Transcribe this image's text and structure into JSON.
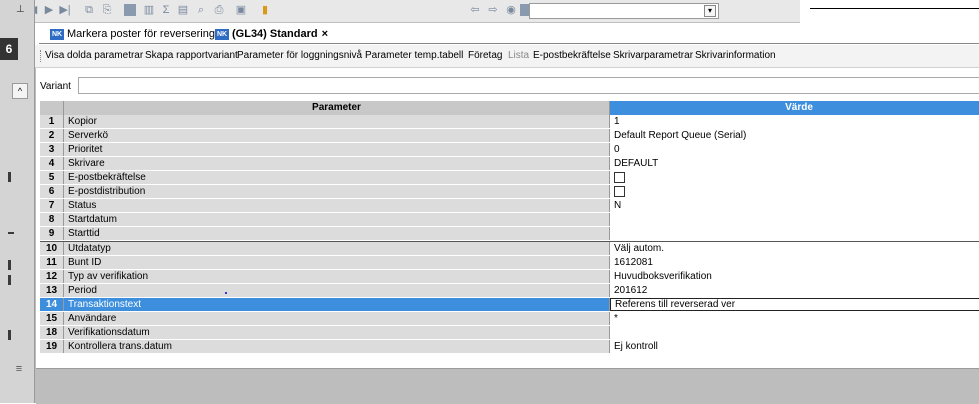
{
  "tabs": [
    {
      "label": "Markera poster för reversering",
      "badge": "NK",
      "active": false,
      "close": "×"
    },
    {
      "label": "(GL34) Standard",
      "badge": "NK",
      "active": true,
      "close": "×"
    }
  ],
  "left_strip": {
    "number": "6"
  },
  "actions": [
    {
      "label": "Visa dolda parametrar",
      "enabled": true
    },
    {
      "label": "Skapa rapportvariant",
      "enabled": true
    },
    {
      "label": "Parameter för loggningsnivå",
      "enabled": true
    },
    {
      "label": "Parameter temp.tabell",
      "enabled": true
    },
    {
      "label": "Företag",
      "enabled": true
    },
    {
      "label": "Lista",
      "enabled": false
    },
    {
      "label": "E-postbekräftelse",
      "enabled": true
    },
    {
      "label": "Skrivarparametrar",
      "enabled": true
    },
    {
      "label": "Skrivarinformation",
      "enabled": true
    }
  ],
  "variant": {
    "label": "Variant",
    "value": ""
  },
  "grid": {
    "headers": {
      "param": "Parameter",
      "value": "Värde"
    },
    "rows": [
      {
        "num": "1",
        "param": "Kopior",
        "value": "1"
      },
      {
        "num": "2",
        "param": "Serverkö",
        "value": "Default Report Queue (Serial)"
      },
      {
        "num": "3",
        "param": "Prioritet",
        "value": "0"
      },
      {
        "num": "4",
        "param": "Skrivare",
        "value": "DEFAULT"
      },
      {
        "num": "5",
        "param": "E-postbekräftelse",
        "value": "",
        "checkbox": true
      },
      {
        "num": "6",
        "param": "E-postdistribution",
        "value": "",
        "checkbox": true
      },
      {
        "num": "7",
        "param": "Status",
        "value": "N"
      },
      {
        "num": "8",
        "param": "Startdatum",
        "value": ""
      },
      {
        "num": "9",
        "param": "Starttid",
        "value": ""
      },
      {
        "num": "10",
        "param": "Utdatatyp",
        "value": "Välj autom."
      },
      {
        "num": "11",
        "param": "Bunt ID",
        "value": "1612081"
      },
      {
        "num": "12",
        "param": "Typ av verifikation",
        "value": "Huvudboksverifikation"
      },
      {
        "num": "13",
        "param": "Period",
        "value": "201612"
      },
      {
        "num": "14",
        "param": "Transaktionstext",
        "value": "Referens till reverserad ver",
        "selected": true
      },
      {
        "num": "15",
        "param": "Användare",
        "value": "*"
      },
      {
        "num": "18",
        "param": "Verifikationsdatum",
        "value": ""
      },
      {
        "num": "19",
        "param": "Kontrollera trans.datum",
        "value": "Ej kontroll"
      }
    ]
  },
  "toolbar_icons": [
    "first-record-icon",
    "prev-record-icon",
    "next-record-icon",
    "last-record-icon",
    "copy-icon",
    "paste-icon",
    "bar-icon",
    "chart-icon",
    "sum-icon",
    "doc-icon",
    "search-icon",
    "print-icon",
    "window-icon",
    "folder-icon",
    "back-arrow-icon",
    "forward-arrow-icon",
    "settings-icon",
    "doc2-icon"
  ]
}
